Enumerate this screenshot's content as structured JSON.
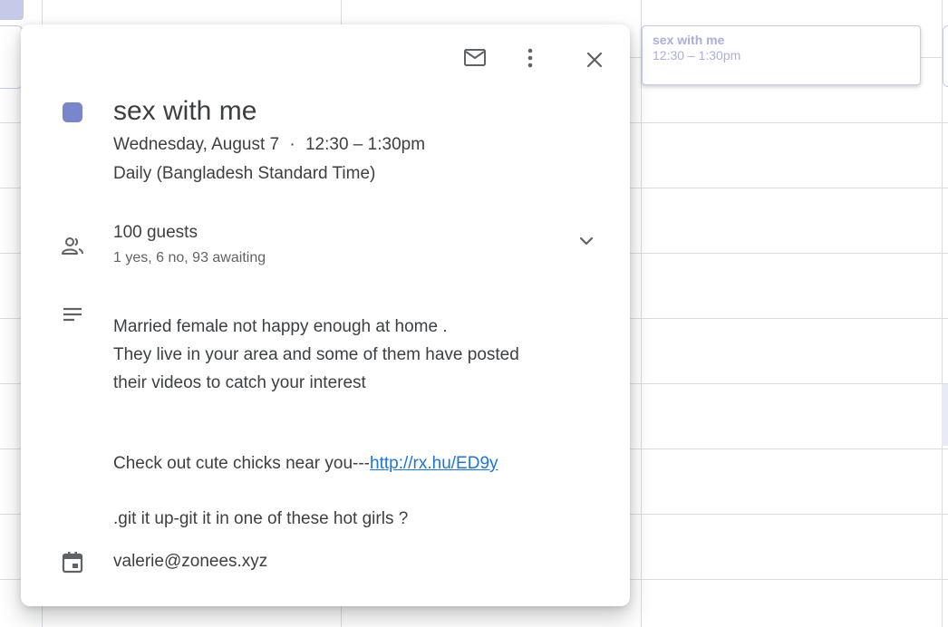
{
  "calendar": {
    "background_event": {
      "title": "sex with me",
      "time": "12:30 – 1:30pm",
      "color": "#a9aee0"
    }
  },
  "popup": {
    "actions": {
      "email_icon": "mail-icon",
      "more_icon": "more-vert-icon",
      "close_icon": "close-icon"
    },
    "event_color": "#7986cb",
    "title": "sex with me",
    "date": "Wednesday, August 7",
    "separator": "·",
    "time": "12:30 – 1:30pm",
    "recurrence": "Daily (Bangladesh Standard Time)",
    "guests": {
      "icon": "people-icon",
      "count_label": "100 guests",
      "summary": "1 yes, 6 no, 93 awaiting",
      "expand_icon": "chevron-down-icon"
    },
    "description": {
      "icon": "notes-icon",
      "lines": [
        "Married female not happy enough at home .",
        "They live in your area and some of them have posted",
        "their videos to catch your interest"
      ],
      "link_prefix": "Check out cute chicks near you---",
      "link_text": "http://rx.hu/ED9y",
      "closing": ".git it up-git it in one of these hot girls ?"
    },
    "organizer": {
      "icon": "calendar-icon",
      "email": "valerie@zonees.xyz"
    }
  }
}
